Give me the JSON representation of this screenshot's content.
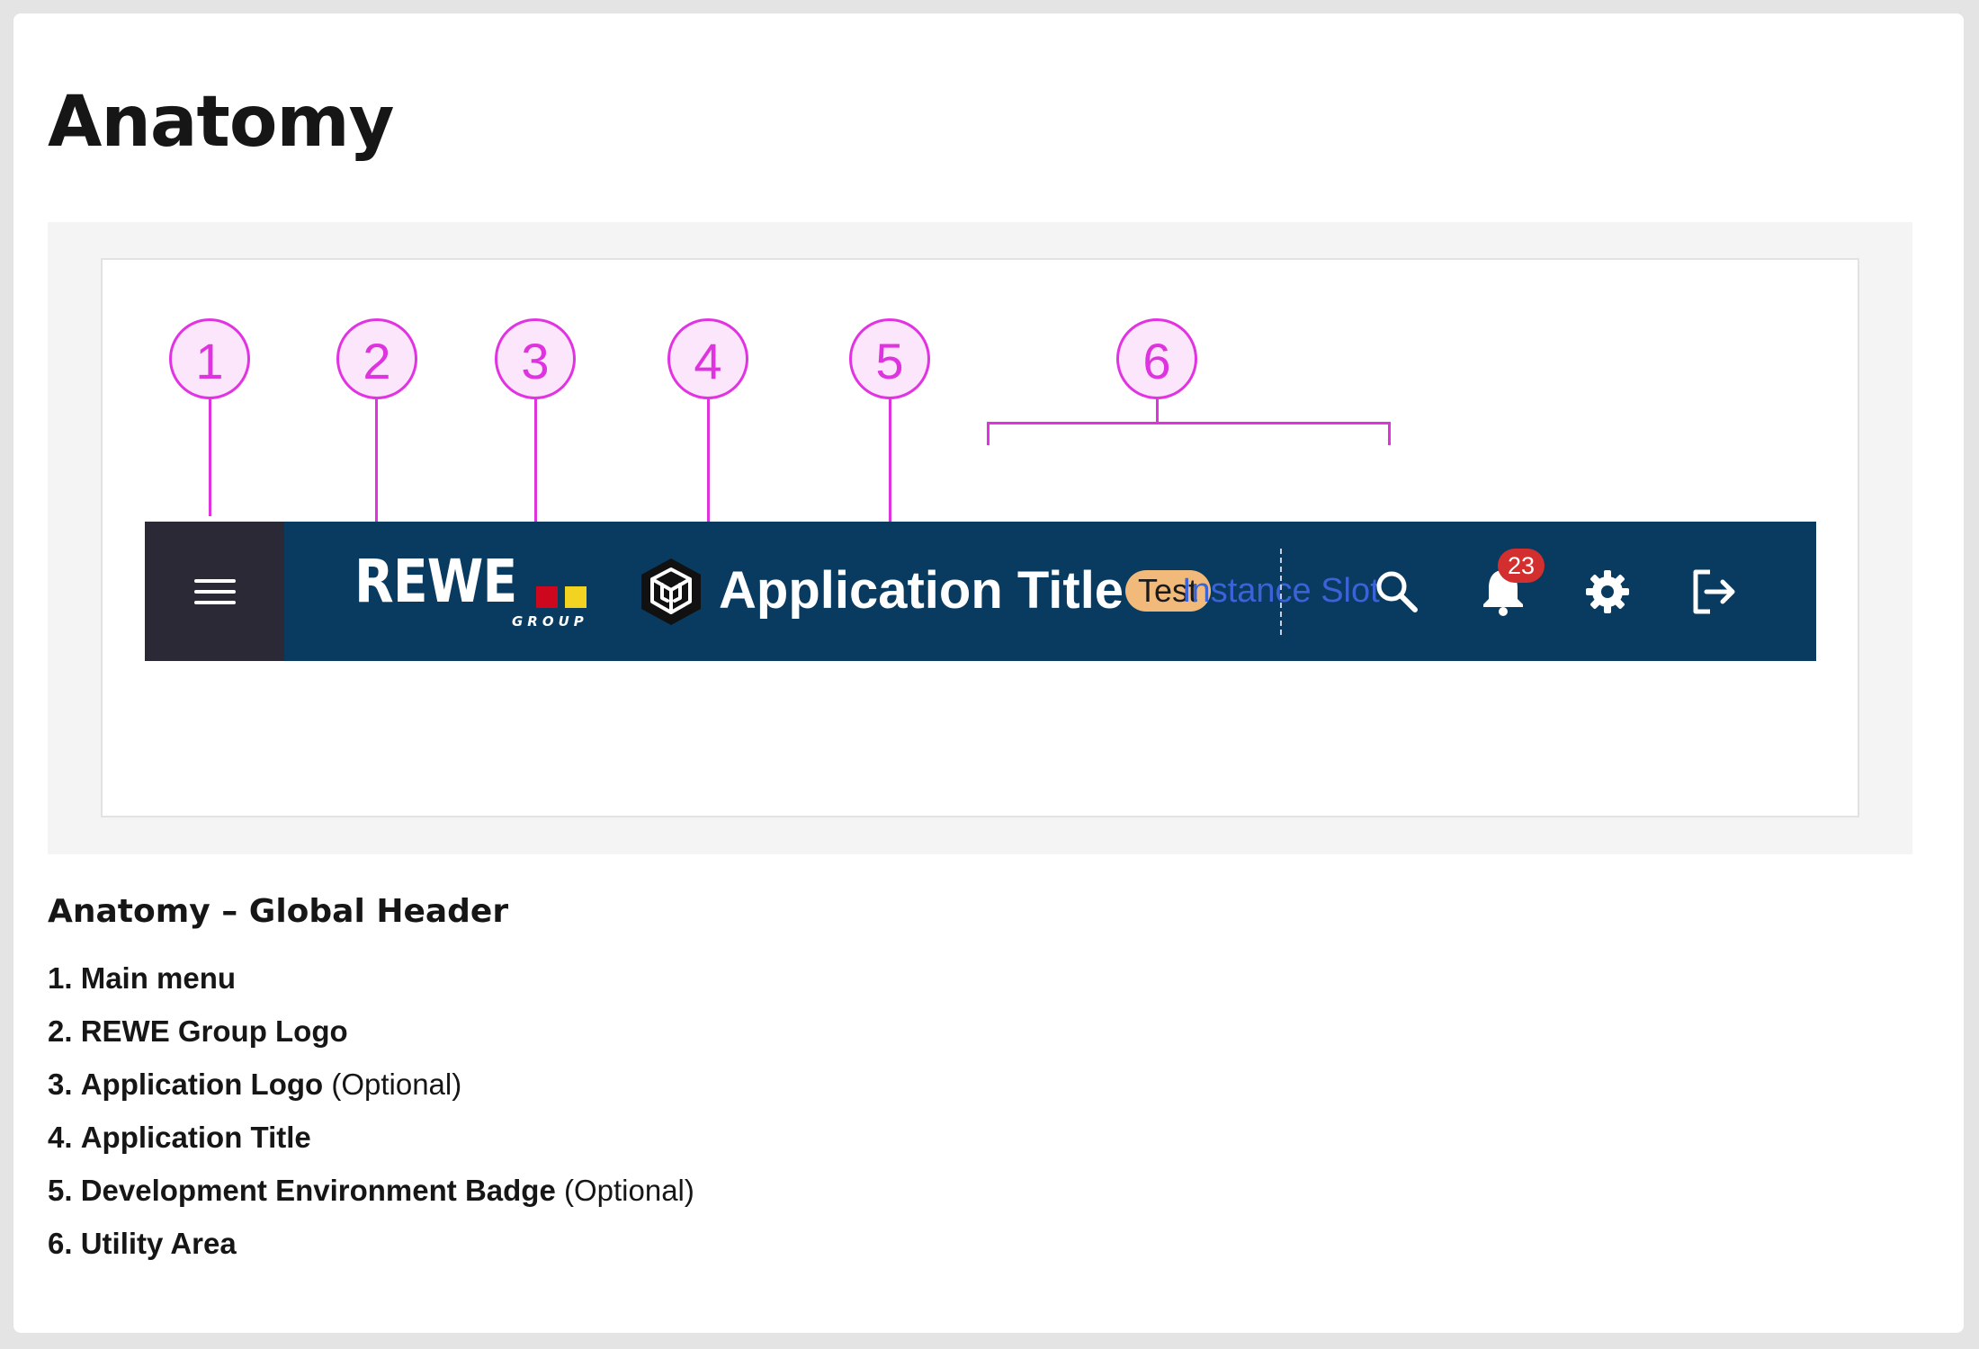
{
  "page": {
    "title": "Anatomy"
  },
  "header": {
    "brand_logo": {
      "word": "REWE",
      "sub": "GROUP"
    },
    "app_title": "Application Title",
    "env_badge": "Test",
    "instance_slot": "Instance Slot",
    "notification_count": "23",
    "icons": [
      "menu-icon",
      "rewe-group-logo",
      "app-logo-icon",
      "search-icon",
      "bell-icon",
      "gear-icon",
      "logout-icon"
    ]
  },
  "markers": [
    "1",
    "2",
    "3",
    "4",
    "5",
    "6"
  ],
  "caption": {
    "title": "Anatomy – Global Header",
    "items": [
      {
        "num": "1.",
        "label": "Main menu",
        "note": ""
      },
      {
        "num": "2.",
        "label": "REWE Group Logo",
        "note": ""
      },
      {
        "num": "3.",
        "label": "Application Logo",
        "note": "(Optional)"
      },
      {
        "num": "4.",
        "label": "Application Title",
        "note": ""
      },
      {
        "num": "5.",
        "label": "Development Environment Badge",
        "note": "(Optional)"
      },
      {
        "num": "6.",
        "label": "Utility Area",
        "note": ""
      }
    ]
  },
  "colors": {
    "header_bg": "#093a5f",
    "menu_bg": "#2b2936",
    "badge_bg": "#f1b97a",
    "slot_text": "#3b63d8",
    "notification": "#d32f2f",
    "annotation": "#df33df",
    "annotation_fill": "#fbe6fb",
    "rewe_red": "#cc071e",
    "rewe_yellow": "#f3d321"
  }
}
